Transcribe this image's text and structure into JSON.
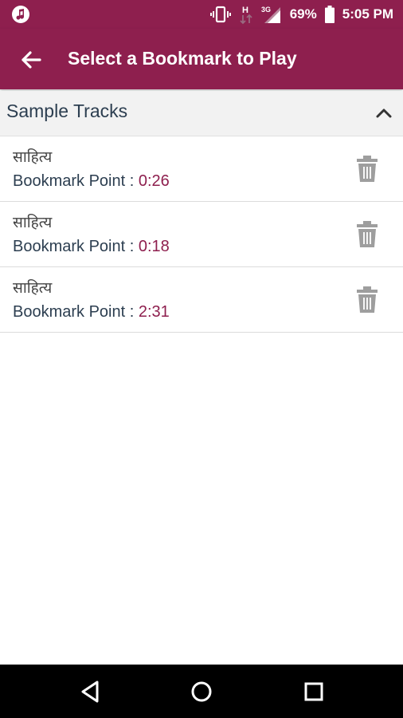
{
  "status_bar": {
    "icons": [
      "music-notification-icon",
      "vibrate-icon",
      "h-data-icon",
      "3g-signal-icon",
      "battery-icon"
    ],
    "network_h": "H",
    "network_3g": "3G",
    "battery": "69%",
    "time": "5:05 PM"
  },
  "app_bar": {
    "title": "Select a Bookmark to Play",
    "back_icon": "arrow-left-icon"
  },
  "section": {
    "title": "Sample Tracks",
    "toggle_icon": "chevron-up-icon"
  },
  "bookmarks": [
    {
      "title": "साहित्य",
      "label": "Bookmark Point : ",
      "time": "0:26"
    },
    {
      "title": "साहित्य",
      "label": "Bookmark Point : ",
      "time": "0:18"
    },
    {
      "title": "साहित्य",
      "label": "Bookmark Point : ",
      "time": "2:31"
    }
  ],
  "nav_bar": {
    "icons": [
      "back-triangle-icon",
      "home-circle-icon",
      "recents-square-icon"
    ]
  },
  "colors": {
    "primary": "#8e1f4e",
    "text": "#2c3e50",
    "header_bg": "#f2f2f2",
    "trash": "#9e9e9e"
  }
}
